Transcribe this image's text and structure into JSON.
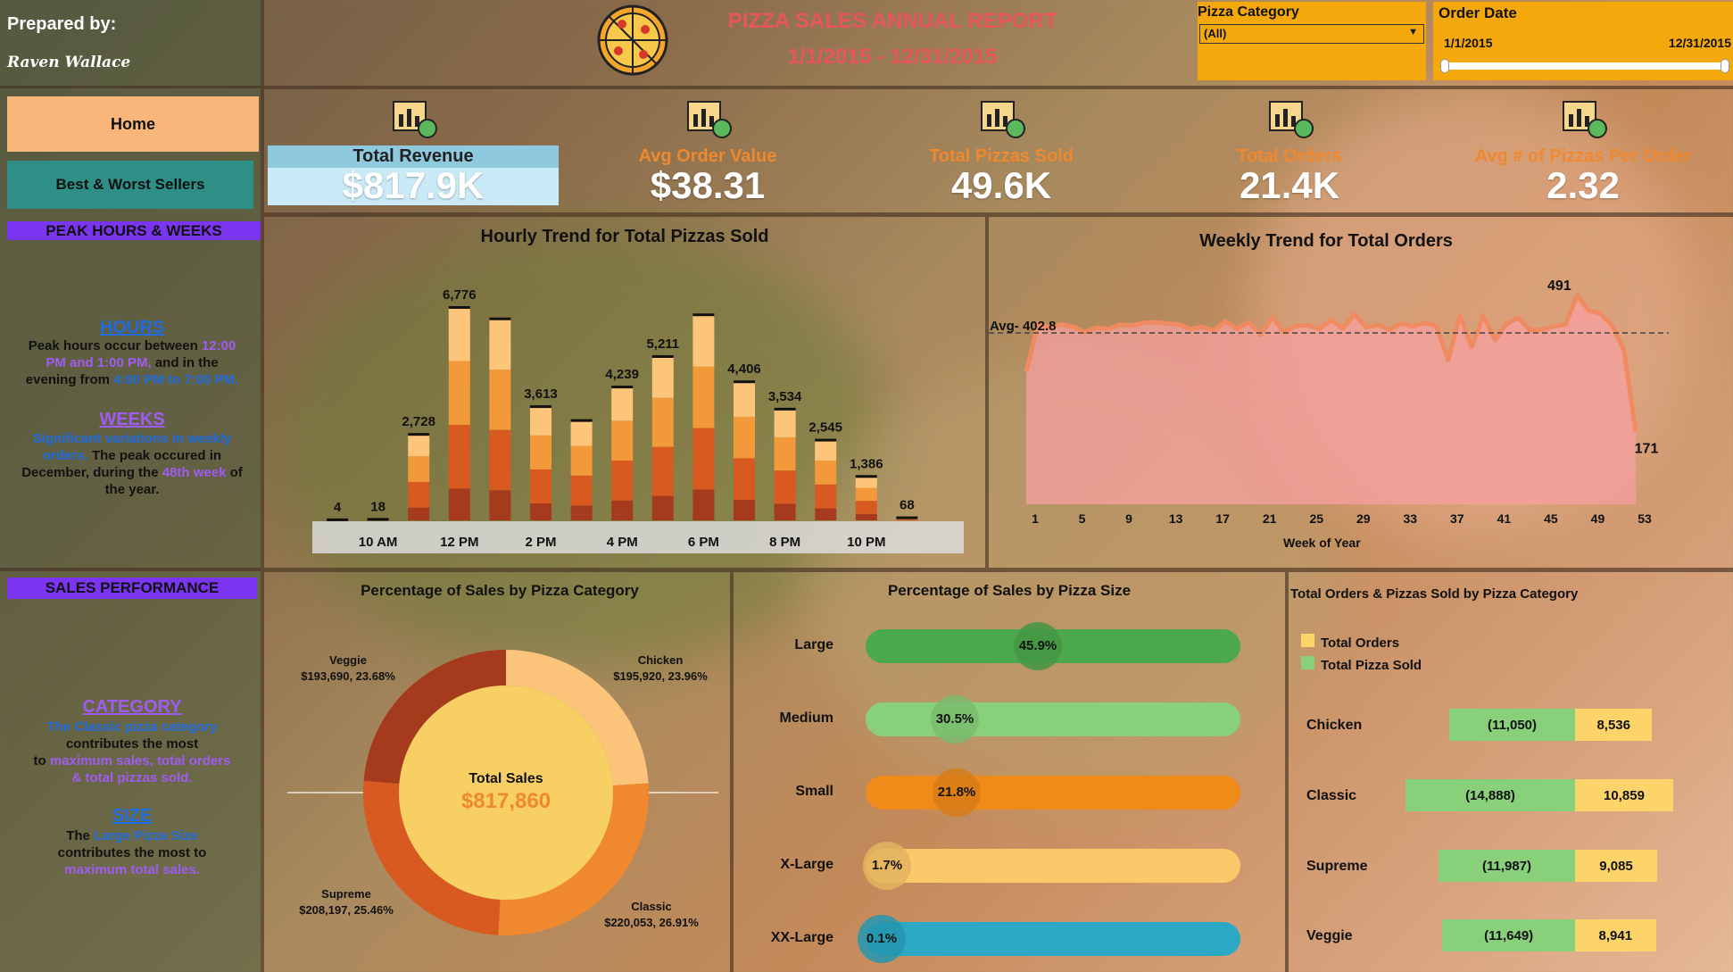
{
  "header": {
    "prepared_by_label": "Prepared by:",
    "author": "Raven Wallace",
    "title": "PIZZA SALES ANNUAL REPORT",
    "date_range": "1/1/2015 - 12/31/2015"
  },
  "filters": {
    "category_label": "Pizza Category",
    "category_value": "(All)",
    "date_label": "Order Date",
    "date_start": "1/1/2015",
    "date_end": "12/31/2015"
  },
  "nav": {
    "home": "Home",
    "best_worst": "Best & Worst Sellers"
  },
  "kpis": [
    {
      "label": "Total Revenue",
      "value": "$817.9K",
      "icon": "money-bag-chart-icon"
    },
    {
      "label": "Avg Order Value",
      "value": "$38.31",
      "icon": "bar-chart-icon"
    },
    {
      "label": "Total Pizzas Sold",
      "value": "49.6K",
      "icon": "clipboard-box-icon"
    },
    {
      "label": "Total Orders",
      "value": "21.4K",
      "icon": "phone-order-icon"
    },
    {
      "label": "Avg # of Pizzas Per Order",
      "value": "2.32",
      "icon": "pizza-stack-icon"
    }
  ],
  "insights": {
    "peak_title": "PEAK HOURS & WEEKS",
    "hours_heading": "HOURS",
    "hours_l1": "Peak hours occur between",
    "hours_l1_hi": "12:00",
    "hours_l2_hi": "PM and 1:00 PM,",
    "hours_l2": "and in the",
    "hours_l3": "evening from",
    "hours_l3_hi": "4:00 PM to 7:00 PM.",
    "weeks_heading": "WEEKS",
    "weeks_l1_hi": "Significant variations in weekly",
    "weeks_l2_hi": "orders.",
    "weeks_l2": "The peak occured in",
    "weeks_l3": "December, during the",
    "weeks_l3_hi": "48th week",
    "weeks_l3b": "of",
    "weeks_l4": "the year.",
    "sales_title": "SALES PERFORMANCE",
    "cat_heading": "CATEGORY",
    "cat_l1_hi": "The Classic pizza category",
    "cat_l2": "contributes the most",
    "cat_l3": "to",
    "cat_l3_hi": "maximum sales, total orders",
    "cat_l4_hi": "& total pizzas sold.",
    "size_heading": "SIZE",
    "size_l1": "The",
    "size_l1_hi": "Large Pizza Size",
    "size_l2": "contributes the most to",
    "size_l3_hi": "maximum total sales."
  },
  "chart_data": [
    {
      "type": "bar",
      "title": "Hourly Trend for Total Pizzas Sold",
      "categories": [
        "9 AM",
        "10 AM",
        "11 AM",
        "12 PM",
        "1 PM",
        "2 PM",
        "3 PM",
        "4 PM",
        "5 PM",
        "6 PM",
        "7 PM",
        "8 PM",
        "9 PM",
        "10 PM",
        "11 PM"
      ],
      "tick_labels": [
        "10 AM",
        "12 PM",
        "2 PM",
        "4 PM",
        "6 PM",
        "8 PM",
        "10 PM"
      ],
      "values": [
        4,
        18,
        2728,
        6776,
        6413,
        3613,
        3170,
        4239,
        5211,
        6542,
        4406,
        3534,
        2545,
        1386,
        68
      ],
      "data_labels": [
        "4",
        "18",
        "2,728",
        "6,776",
        "",
        "3,613",
        "",
        "4,239",
        "5,211",
        "",
        "4,406",
        "3,534",
        "2,545",
        "1,386",
        "68"
      ],
      "stack_fractions": [
        0.15,
        0.3,
        0.3,
        0.25
      ],
      "colors": [
        "#a63a1c",
        "#d95a20",
        "#f29a3a",
        "#fcc57a"
      ]
    },
    {
      "type": "area",
      "title": "Weekly Trend for Total Orders",
      "xlabel": "Week of Year",
      "x_ticks": [
        1,
        5,
        9,
        13,
        17,
        21,
        25,
        29,
        33,
        37,
        41,
        45,
        49,
        53
      ],
      "values": [
        311,
        425,
        415,
        423,
        417,
        404,
        415,
        412,
        422,
        420,
        426,
        428,
        425,
        423,
        412,
        417,
        408,
        430,
        412,
        428,
        398,
        440,
        404,
        419,
        421,
        412,
        433,
        413,
        446,
        416,
        421,
        410,
        425,
        418,
        426,
        419,
        339,
        445,
        370,
        443,
        386,
        425,
        438,
        409,
        410,
        418,
        422,
        491,
        455,
        448,
        419,
        362,
        171
      ],
      "average": 402.8,
      "avg_label": "Avg- 402.8",
      "peak_label": "491",
      "last_label": "171",
      "ylim": [
        0,
        560
      ],
      "color": "#f08a60"
    },
    {
      "type": "pie",
      "title": "Percentage of Sales by Pizza Category",
      "center_title": "Total Sales",
      "center_value": "$817,860",
      "slices": [
        {
          "name": "Chicken",
          "amount": "$195,920",
          "pct": "23.96%",
          "value": 23.96,
          "color": "#fcc37a"
        },
        {
          "name": "Classic",
          "amount": "$220,053",
          "pct": "26.91%",
          "value": 26.91,
          "color": "#f0882e"
        },
        {
          "name": "Supreme",
          "amount": "$208,197",
          "pct": "25.46%",
          "value": 25.46,
          "color": "#d95a20"
        },
        {
          "name": "Veggie",
          "amount": "$193,690",
          "pct": "23.68%",
          "value": 23.68,
          "color": "#a63a1c"
        }
      ]
    },
    {
      "type": "bar",
      "title": "Percentage of Sales by Pizza Size",
      "categories": [
        "Large",
        "Medium",
        "Small",
        "X-Large",
        "XX-Large"
      ],
      "values": [
        45.9,
        30.5,
        21.8,
        1.7,
        0.1
      ],
      "value_labels": [
        "45.9%",
        "30.5%",
        "21.8%",
        "1.7%",
        "0.1%"
      ],
      "colors": [
        "#4ca84c",
        "#88d17a",
        "#f08a18",
        "#fcc96a",
        "#2aa8c4"
      ]
    },
    {
      "type": "bar",
      "title": "Total Orders & Pizzas Sold by Pizza Category",
      "legend": [
        "Total Orders",
        "Total Pizza Sold"
      ],
      "categories": [
        "Chicken",
        "Classic",
        "Supreme",
        "Veggie"
      ],
      "pizzas_sold": [
        11050,
        14888,
        11987,
        11649
      ],
      "pizzas_labels": [
        "(11,050)",
        "(14,888)",
        "(11,987)",
        "(11,649)"
      ],
      "orders": [
        8536,
        10859,
        9085,
        8941
      ],
      "orders_labels": [
        "8,536",
        "10,859",
        "9,085",
        "8,941"
      ],
      "colors": {
        "orders": "#fcd46a",
        "pizzas": "#88d17a"
      }
    }
  ]
}
